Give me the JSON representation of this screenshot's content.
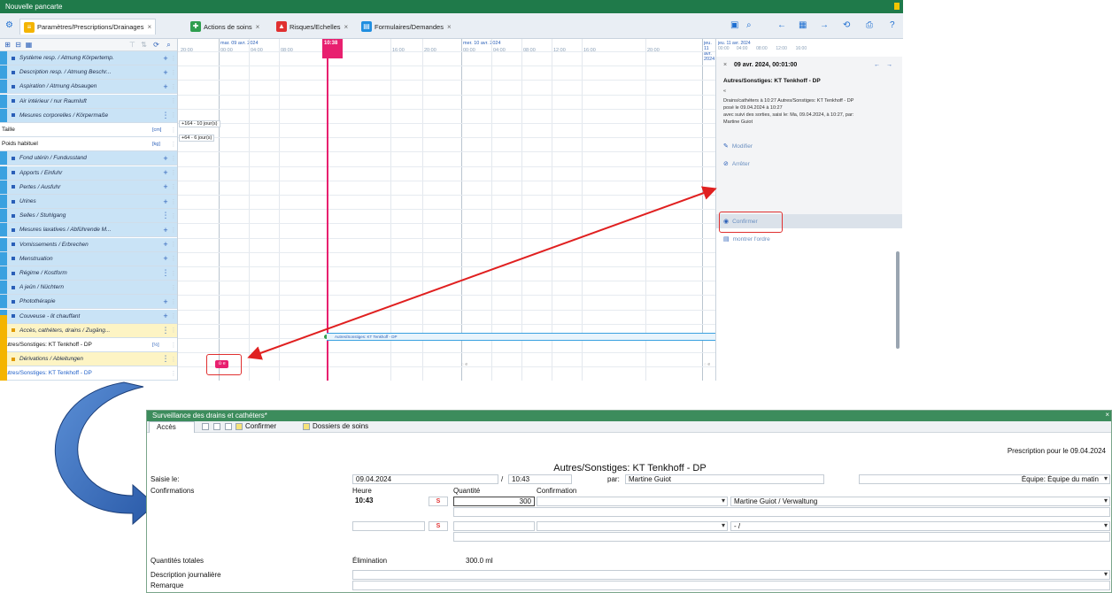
{
  "top_window": {
    "title": "Nouvelle pancarte",
    "tabs": [
      {
        "label": "Paramètres/Prescriptions/Drainages",
        "close": "×"
      },
      {
        "label": "Actions de soins",
        "close": "×"
      },
      {
        "label": "Risques/Echelles",
        "close": "×"
      },
      {
        "label": "Formulaires/Demandes",
        "close": "×"
      }
    ],
    "colors": {
      "title_bar": "#1f7a4a",
      "now_line": "#e8206f",
      "highlight": "#e03030",
      "blue_row": "#c9e3f6",
      "yellow_row": "#fdf4c4"
    },
    "left_list": [
      {
        "label": "Système resp. / Atmung Körpertemp.",
        "kind": "blue",
        "action": "+"
      },
      {
        "label": "Description resp. / Atmung Beschr...",
        "kind": "blue",
        "action": "+"
      },
      {
        "label": "Aspiration / Atmung Absaugen",
        "kind": "blue",
        "action": "+"
      },
      {
        "label": "Air intérieur / nur Raumluft",
        "kind": "blue",
        "action": ""
      },
      {
        "label": "Mesures corporelles / Körpermaße",
        "kind": "blue",
        "action": "⋮"
      },
      {
        "label": "Taille",
        "kind": "white",
        "action": "",
        "unit": "[cm]"
      },
      {
        "label": "Poids habituel",
        "kind": "white",
        "action": "",
        "unit": "[kg]"
      },
      {
        "label": "Fond utérin / Fundusstand",
        "kind": "blue",
        "action": "+"
      },
      {
        "label": "Apports / Einfuhr",
        "kind": "blue",
        "action": "+"
      },
      {
        "label": "Pertes / Ausfuhr",
        "kind": "blue",
        "action": "+"
      },
      {
        "label": "Urines",
        "kind": "blue",
        "action": "+"
      },
      {
        "label": "Selles / Stuhlgang",
        "kind": "blue",
        "action": "⋮"
      },
      {
        "label": "Mesures laxatives / Abführende M...",
        "kind": "blue",
        "action": "+"
      },
      {
        "label": "Vomissements / Erbrechen",
        "kind": "blue",
        "action": "+"
      },
      {
        "label": "Menstruation",
        "kind": "blue",
        "action": "+"
      },
      {
        "label": "Régime / Kostform",
        "kind": "blue",
        "action": "⋮"
      },
      {
        "label": "A jeûn / Nüchtern",
        "kind": "blue",
        "action": ""
      },
      {
        "label": "Photothérapie",
        "kind": "blue",
        "action": "+"
      },
      {
        "label": "Couveuse - lit chauffant",
        "kind": "blue",
        "action": "+"
      },
      {
        "label": "Accès, cathéters, drains / Zugäng...",
        "kind": "yellow",
        "action": "⋮"
      },
      {
        "label": "Autres/Sonstiges: KT Tenkhoff - DP",
        "kind": "white",
        "action": "",
        "unit": "[½]"
      },
      {
        "label": "Dérivations / Ableitungen",
        "kind": "yellow",
        "action": "⋮"
      },
      {
        "label": "Autres/Sonstiges: KT Tenkhoff - DP",
        "kind": "white-blue",
        "action": ""
      }
    ],
    "grid": {
      "days": [
        "mar. 09 avr. 2024",
        "mer. 10 avr. 2024",
        "jeu. 11 avr. 2024"
      ],
      "times_day0": [
        "20:00",
        "00:00",
        "04:00",
        "08:00"
      ],
      "times_day1": [
        "16:00",
        "20:00",
        "00:00",
        "04:00",
        "08:00",
        "12:00",
        "16:00",
        "20:00"
      ],
      "times_day2": [
        "00:00",
        "04:00",
        "08:00",
        "12:00",
        "16:00"
      ],
      "now_label": "10:38",
      "chip_taille": "+164 - 10 jour(s)",
      "chip_poids": "+64 - 6 jour(s)",
      "drain_label": "Autres/Sonstiges: KT Tenkhoff - DP",
      "event_marker": "⊙ e"
    },
    "detail_panel": {
      "close": "×",
      "date": "09 avr. 2024, 00:01:00",
      "title": "Autres/Sonstiges: KT Tenkhoff - DP",
      "lines": [
        "«",
        "Drains/cathéters à 10:27 Autres/Sonstiges: KT Tenkhoff - DP",
        "posé le 09.04.2024 à 10:27",
        "avec suivi des sorties, saisi le: Ma, 09.04.2024, à 10:27, par:",
        "Martine Guiot"
      ],
      "actions": [
        "Modifier",
        "Arrêter",
        "Confirmer",
        "montrer l'ordre"
      ]
    }
  },
  "dialog": {
    "title": "Surveillance des drains et cathéters*",
    "close": "×",
    "menu": {
      "tab": "Accès",
      "confirm": "Confirmer",
      "dossiers": "Dossiers de soins"
    },
    "prescription": "Prescription pour le 09.04.2024",
    "subtitle": "Autres/Sonstiges: KT Tenkhoff - DP",
    "saisie_label": "Saisie le:",
    "saisie_date": "09.04.2024",
    "slash": "/",
    "saisie_time": "10:43",
    "par_label": "par:",
    "par_value": "Martine Guiot",
    "equipe": "Équipe: Équipe du matin",
    "confirmations_label": "Confirmations",
    "col_heure": "Heure",
    "col_quantite": "Quantité",
    "col_confirmation": "Confirmation",
    "row1": {
      "heure": "10:43",
      "s": "S",
      "quantite": "300",
      "confirm_by": "Martine Guiot / Verwaltung"
    },
    "row2": {
      "heure": "",
      "s": "S",
      "quantite": "",
      "confirm_by": "- /"
    },
    "totals_label": "Quantités totales",
    "elimination_label": "Élimination",
    "elimination_value": "300.0  ml",
    "description_label": "Description journalière",
    "remarque_label": "Remarque"
  }
}
